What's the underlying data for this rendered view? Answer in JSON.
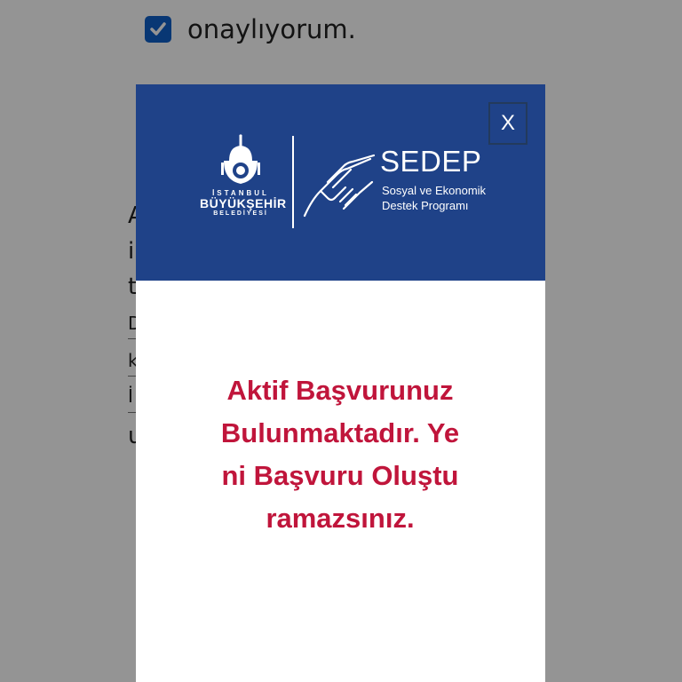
{
  "background": {
    "checkbox_label": "onaylıyorum.",
    "checkbox_checked": true,
    "text_fragments": [
      "A",
      "i",
      "t",
      "D",
      "k",
      "İ",
      "u"
    ]
  },
  "modal": {
    "close_label": "X",
    "logo": {
      "ibb_top": "İSTANBUL",
      "ibb_mid": "BÜYÜKŞEHİR",
      "ibb_bottom": "BELEDİYESİ",
      "sedep_title": "SEDEP",
      "sedep_subtitle_1": "Sosyal ve Ekonomik",
      "sedep_subtitle_2": "Destek Programı"
    },
    "message": "Aktif Başvurunuz Bulunmaktadır. Yeni Başvuru Oluşturamazsınız."
  },
  "colors": {
    "header_blue": "#1f4288",
    "message_red": "#c0153b",
    "checkbox_blue": "#0f5fc9"
  }
}
